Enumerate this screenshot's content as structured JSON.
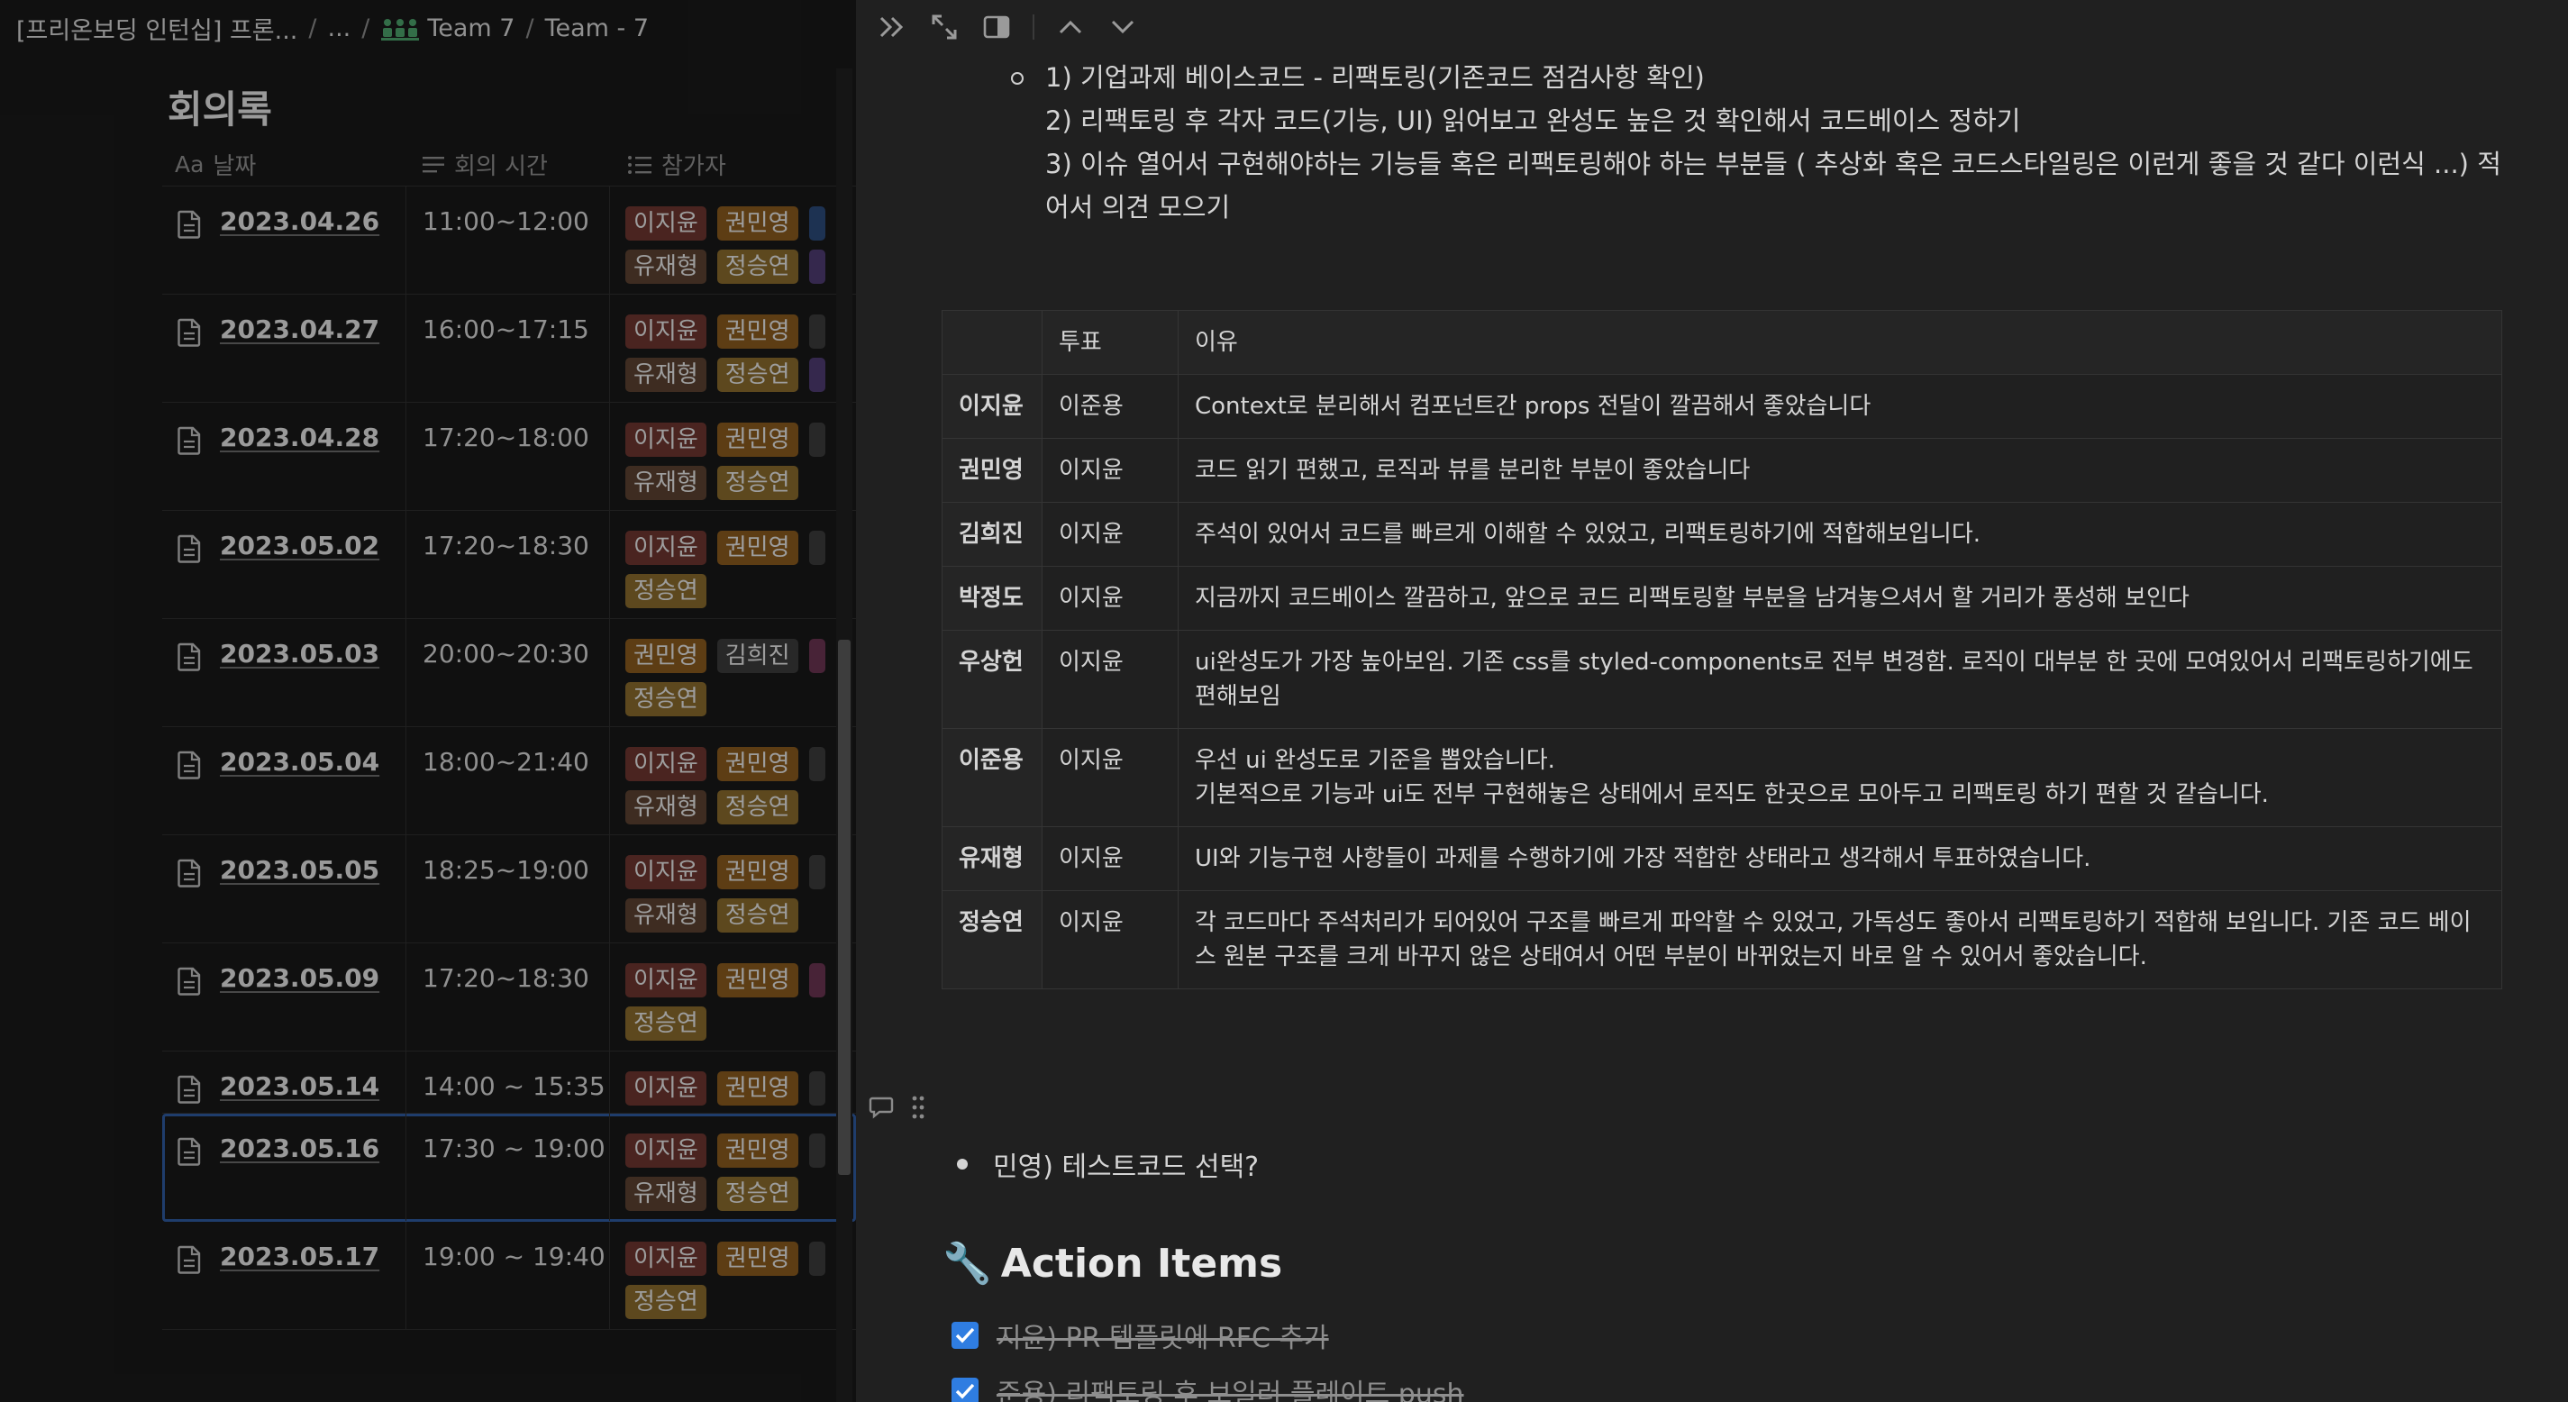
{
  "breadcrumb": {
    "root": "[프리온보딩 인턴십] 프론...",
    "ellipsis": "...",
    "team": "Team 7",
    "page": "Team - 7"
  },
  "database": {
    "title": "회의록",
    "columns": {
      "date_icon": "Aa",
      "date": "날짜",
      "time": "회의 시간",
      "participants": "참가자"
    },
    "rows": [
      {
        "date": "2023.04.26",
        "time": "11:00~12:00",
        "tags": [
          [
            "이지윤",
            "t-red"
          ],
          [
            "권민영",
            "t-orange"
          ],
          [
            "",
            "t-blue"
          ],
          [
            "유재형",
            "t-brown"
          ],
          [
            "정승연",
            "t-yellow"
          ],
          [
            "",
            "t-purple"
          ]
        ]
      },
      {
        "date": "2023.04.27",
        "time": "16:00~17:15",
        "tags": [
          [
            "이지윤",
            "t-red"
          ],
          [
            "권민영",
            "t-orange"
          ],
          [
            "",
            "t-gray"
          ],
          [
            "유재형",
            "t-brown"
          ],
          [
            "정승연",
            "t-yellow"
          ],
          [
            "",
            "t-purple"
          ]
        ]
      },
      {
        "date": "2023.04.28",
        "time": "17:20~18:00",
        "tags": [
          [
            "이지윤",
            "t-red"
          ],
          [
            "권민영",
            "t-orange"
          ],
          [
            "",
            "t-gray"
          ],
          [
            "유재형",
            "t-brown"
          ],
          [
            "정승연",
            "t-yellow"
          ]
        ]
      },
      {
        "date": "2023.05.02",
        "time": "17:20~18:30",
        "tags": [
          [
            "이지윤",
            "t-red"
          ],
          [
            "권민영",
            "t-orange"
          ],
          [
            "",
            "t-gray"
          ],
          [
            "정승연",
            "t-yellow"
          ]
        ]
      },
      {
        "date": "2023.05.03",
        "time": "20:00~20:30",
        "tags": [
          [
            "권민영",
            "t-orange"
          ],
          [
            "김희진",
            "t-gray"
          ],
          [
            "",
            "t-pink"
          ],
          [
            "정승연",
            "t-yellow"
          ]
        ]
      },
      {
        "date": "2023.05.04",
        "time": "18:00~21:40",
        "tags": [
          [
            "이지윤",
            "t-red"
          ],
          [
            "권민영",
            "t-orange"
          ],
          [
            "",
            "t-gray"
          ],
          [
            "유재형",
            "t-brown"
          ],
          [
            "정승연",
            "t-yellow"
          ]
        ]
      },
      {
        "date": "2023.05.05",
        "time": "18:25~19:00",
        "tags": [
          [
            "이지윤",
            "t-red"
          ],
          [
            "권민영",
            "t-orange"
          ],
          [
            "",
            "t-gray"
          ],
          [
            "유재형",
            "t-brown"
          ],
          [
            "정승연",
            "t-yellow"
          ]
        ]
      },
      {
        "date": "2023.05.09",
        "time": "17:20~18:30",
        "tags": [
          [
            "이지윤",
            "t-red"
          ],
          [
            "권민영",
            "t-orange"
          ],
          [
            "",
            "t-pink"
          ],
          [
            "정승연",
            "t-yellow"
          ]
        ]
      },
      {
        "date": "2023.05.14",
        "time": "14:00 ~ 15:35",
        "tags": [
          [
            "이지윤",
            "t-red"
          ],
          [
            "권민영",
            "t-orange"
          ],
          [
            "",
            "t-gray"
          ]
        ],
        "short": true
      },
      {
        "date": "2023.05.16",
        "time": "17:30 ~ 19:00",
        "tags": [
          [
            "이지윤",
            "t-red"
          ],
          [
            "권민영",
            "t-orange"
          ],
          [
            "",
            "t-gray"
          ],
          [
            "유재형",
            "t-brown"
          ],
          [
            "정승연",
            "t-yellow"
          ]
        ],
        "selected": true
      },
      {
        "date": "2023.05.17",
        "time": "19:00 ~ 19:40",
        "tags": [
          [
            "이지윤",
            "t-red"
          ],
          [
            "권민영",
            "t-orange"
          ],
          [
            "",
            "t-gray"
          ],
          [
            "정승연",
            "t-yellow"
          ]
        ]
      }
    ]
  },
  "peek": {
    "outline": [
      "1) 기업과제 베이스코드 - 리팩토링(기존코드 점검사항 확인)",
      "2) 리팩토링 후 각자 코드(기능, UI) 읽어보고 완성도 높은 것 확인해서 코드베이스 정하기",
      "3) 이슈 열어서 구현해야하는 기능들 혹은 리팩토링해야 하는 부분들 ( 추상화 혹은 코드스타일링은 이런게 좋을 것 같다 이런식 ...) 적어서 의견 모으기"
    ],
    "table": {
      "headers": [
        "",
        "투표",
        "이유"
      ],
      "rows": [
        [
          "이지윤",
          "이준용",
          "Context로 분리해서 컴포넌트간 props 전달이 깔끔해서 좋았습니다"
        ],
        [
          "권민영",
          "이지윤",
          "코드 읽기 편했고, 로직과 뷰를 분리한 부분이 좋았습니다"
        ],
        [
          "김희진",
          "이지윤",
          "주석이 있어서 코드를 빠르게 이해할 수 있었고, 리팩토링하기에 적합해보입니다."
        ],
        [
          "박정도",
          "이지윤",
          "지금까지 코드베이스 깔끔하고, 앞으로 코드 리팩토링할 부분을 남겨놓으셔서 할 거리가 풍성해 보인다"
        ],
        [
          "우상헌",
          "이지윤",
          "ui완성도가 가장 높아보임. 기존 css를 styled-components로 전부 변경함. 로직이 대부분 한 곳에 모여있어서 리팩토링하기에도 편해보임"
        ],
        [
          "이준용",
          "이지윤",
          "우선 ui 완성도로 기준을 뽑았습니다.\n기본적으로 기능과 ui도 전부 구현해놓은 상태에서 로직도 한곳으로 모아두고 리팩토링 하기 편할 것 같습니다."
        ],
        [
          "유재형",
          "이지윤",
          "UI와 기능구현 사항들이 과제를 수행하기에 가장 적합한 상태라고 생각해서 투표하였습니다."
        ],
        [
          "정승연",
          "이지윤",
          "각 코드마다 주석처리가 되어있어 구조를 빠르게 파악할 수 있었고, 가독성도 좋아서 리팩토링하기 적합해 보입니다. 기존 코드 베이스 원본 구조를 크게 바꾸지 않은 상태여서 어떤 부분이 바뀌었는지 바로 알 수 있어서 좋았습니다."
        ]
      ]
    },
    "bullet": "민영) 테스트코드 선택?",
    "action_heading": "Action Items",
    "action_emoji": "🔧",
    "todos": [
      {
        "text": "지윤) PR 템플릿에 RFC 추가",
        "checked": true
      },
      {
        "text": "준용) 리팩토링 후 보일러 플레이트 push",
        "checked": true
      }
    ]
  },
  "colors": {
    "check": "#2f7de1",
    "selected_outline": "#2f5aa0",
    "team_icon": "#4ca36b"
  },
  "icons": [
    "team-icon",
    "page-icon",
    "double-chevron-right-icon",
    "expand-icon",
    "side-panel-icon",
    "chevron-up-icon",
    "chevron-down-icon",
    "comment-icon",
    "drag-handle-icon",
    "checkbox-checked-icon"
  ]
}
